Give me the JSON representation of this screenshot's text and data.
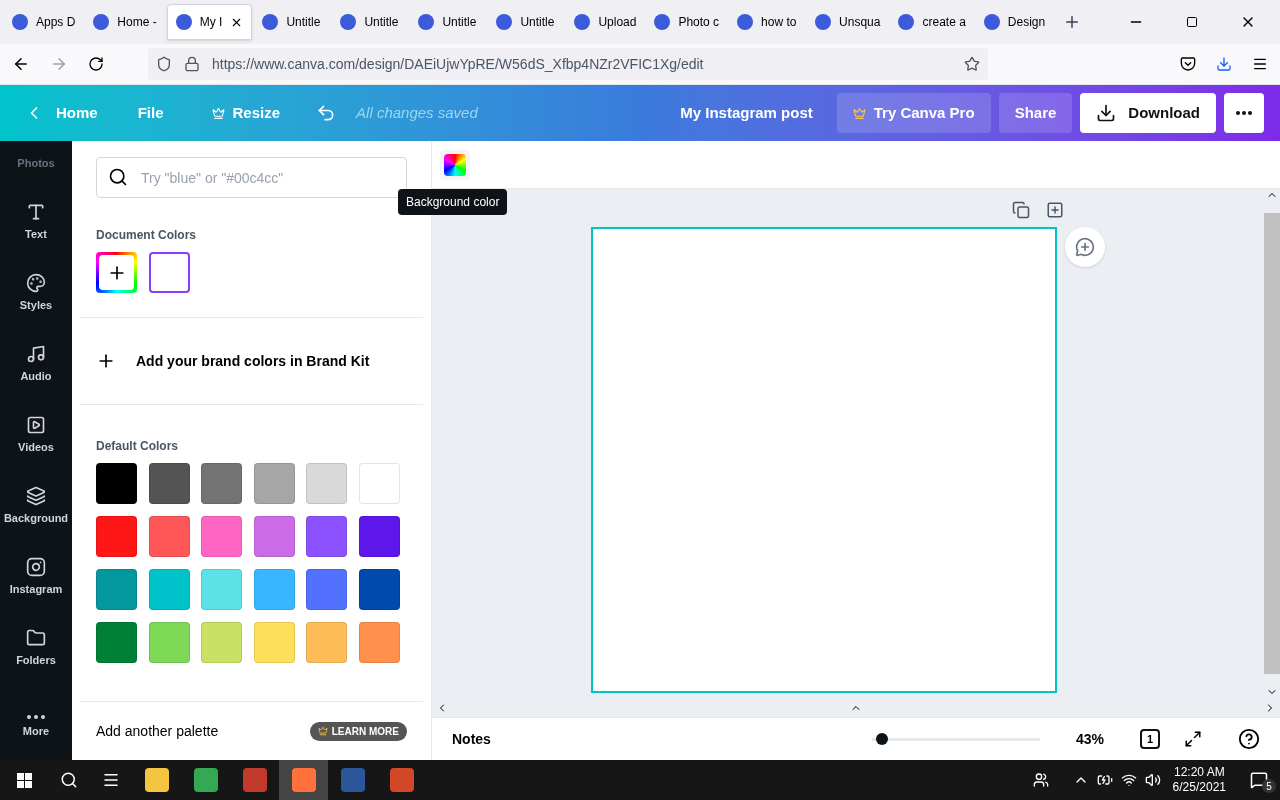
{
  "browser": {
    "tabs": [
      {
        "label": "Apps D",
        "selected": false
      },
      {
        "label": "Home -",
        "selected": false
      },
      {
        "label": "My I",
        "selected": true
      },
      {
        "label": "Untitle",
        "selected": false
      },
      {
        "label": "Untitle",
        "selected": false
      },
      {
        "label": "Untitle",
        "selected": false
      },
      {
        "label": "Untitle",
        "selected": false
      },
      {
        "label": "Upload",
        "selected": false
      },
      {
        "label": "Photo c",
        "selected": false
      },
      {
        "label": "how to",
        "selected": false
      },
      {
        "label": "Unsqua",
        "selected": false
      },
      {
        "label": "create a",
        "selected": false
      },
      {
        "label": "Design",
        "selected": false
      }
    ],
    "url": "https://www.canva.com/design/DAEiUjwYpRE/W56dS_Xfbp4NZr2VFIC1Xg/edit"
  },
  "header": {
    "home": "Home",
    "file": "File",
    "resize": "Resize",
    "status": "All changes saved",
    "title": "My Instagram post",
    "pro": "Try Canva Pro",
    "share": "Share",
    "download": "Download"
  },
  "sidebar": [
    {
      "label": "Photos"
    },
    {
      "label": "Text"
    },
    {
      "label": "Styles"
    },
    {
      "label": "Audio"
    },
    {
      "label": "Videos"
    },
    {
      "label": "Background"
    },
    {
      "label": "Instagram"
    },
    {
      "label": "Folders"
    },
    {
      "label": "More"
    }
  ],
  "panel": {
    "search_placeholder": "Try \"blue\" or \"#00c4cc\"",
    "document_title": "Document Colors",
    "document_colors": [
      {
        "color": "#ffffff",
        "selected": true
      }
    ],
    "brand": "Add your brand colors in Brand Kit",
    "default_title": "Default Colors",
    "default_colors": [
      {
        "color": "#000000"
      },
      {
        "color": "#545454"
      },
      {
        "color": "#737373"
      },
      {
        "color": "#a6a6a6"
      },
      {
        "color": "#d9d9d9"
      },
      {
        "color": "#ffffff"
      },
      {
        "color": "#ff1616"
      },
      {
        "color": "#ff5757"
      },
      {
        "color": "#ff66c4"
      },
      {
        "color": "#cb6ce6"
      },
      {
        "color": "#8c52ff"
      },
      {
        "color": "#5e17eb"
      },
      {
        "color": "#03989e"
      },
      {
        "color": "#00c2cb"
      },
      {
        "color": "#5ce1e6"
      },
      {
        "color": "#38b6ff"
      },
      {
        "color": "#5271ff"
      },
      {
        "color": "#004aad"
      },
      {
        "color": "#008037"
      },
      {
        "color": "#7ed957"
      },
      {
        "color": "#c9e265"
      },
      {
        "color": "#ffde59"
      },
      {
        "color": "#ffbd59"
      },
      {
        "color": "#ff914d"
      }
    ],
    "another": "Add another palette",
    "learn": "LEARN MORE"
  },
  "tooltip": "Background color",
  "footer": {
    "notes": "Notes",
    "zoom": {
      "level": 0.06
    },
    "zoom_reading": "43%",
    "page": "1"
  },
  "taskbar": {
    "time": "12:20 AM",
    "date": "6/25/2021",
    "notifications": "5"
  }
}
